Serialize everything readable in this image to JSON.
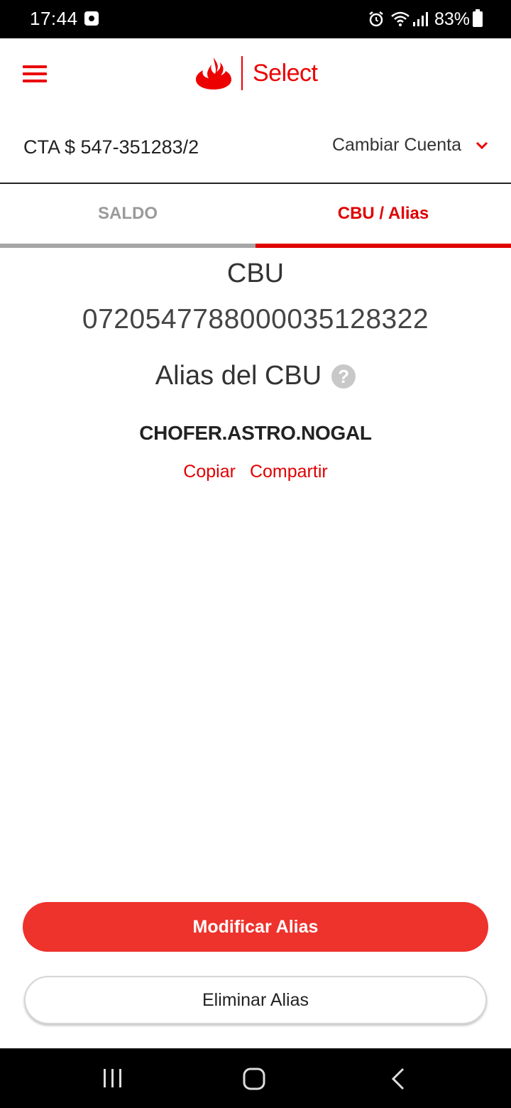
{
  "status_bar": {
    "time": "17:44",
    "battery": "83%",
    "icons": [
      "notification-icon",
      "alarm-icon",
      "wifi-icon",
      "signal-icon",
      "battery-icon"
    ]
  },
  "header": {
    "brand": "Select",
    "icons": [
      "menu-icon",
      "santander-flame-logo"
    ]
  },
  "account": {
    "number": "CTA $ 547-351283/2",
    "change_label": "Cambiar Cuenta"
  },
  "tabs": [
    {
      "label": "SALDO",
      "active": false
    },
    {
      "label": "CBU / Alias",
      "active": true
    }
  ],
  "cbu": {
    "heading": "CBU",
    "number": "0720547788000035128322"
  },
  "alias": {
    "heading": "Alias del CBU",
    "help_icon": "?",
    "value": "CHOFER.ASTRO.NOGAL",
    "copy_label": "Copiar",
    "share_label": "Compartir"
  },
  "buttons": {
    "modify": "Modificar Alias",
    "delete": "Eliminar Alias"
  },
  "colors": {
    "brand_red": "#ec0000",
    "primary_button": "#ee322c",
    "inactive_tab": "#9a9a9a"
  }
}
